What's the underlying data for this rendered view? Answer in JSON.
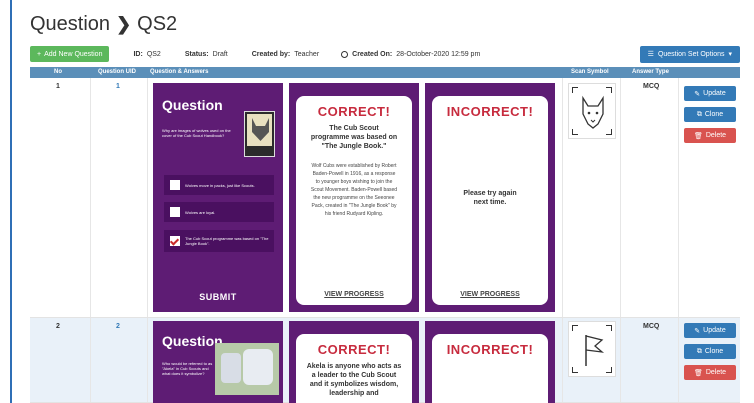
{
  "header": {
    "title": "Question",
    "subtitle": "QS2"
  },
  "info": {
    "add_label": "Add New Question",
    "id_label": "ID:",
    "id_value": "QS2",
    "status_label": "Status:",
    "status_value": "Draft",
    "created_by_label": "Created by:",
    "created_by_value": "Teacher",
    "created_on_label": "Created On:",
    "created_on_value": "28-October-2020 12:59 pm",
    "options_label": "Question Set Options"
  },
  "table": {
    "headers": {
      "no": "No",
      "uid": "Question UID",
      "qa": "Question & Answers",
      "scan": "Scan Symbol",
      "type": "Answer Type"
    }
  },
  "rows": [
    {
      "no": "1",
      "uid": "1",
      "type": "MCQ",
      "question_title": "Question",
      "question_text": "Why are images of wolves used on the cover of the Cub Scout Handbook?",
      "options": [
        "Wolves move in packs, just like Scouts.",
        "Wolves are loyal.",
        "The Cub Scout programme was based on \"The Jungle Book\"."
      ],
      "submit": "SUBMIT",
      "correct_title": "CORRECT!",
      "correct_sub": "The Cub Scout programme was based on \"The Jungle Book.\"",
      "correct_body": "Wolf Cubs were established by Robert Baden-Powell in 1916, as a response to younger boys wishing to join the Scout Movement. Baden-Powell based the new programme on the Seeonee Pack, created in \"The Jungle Book\" by his friend Rudyard Kipling.",
      "incorrect_title": "INCORRECT!",
      "incorrect_body": "Please try again next time.",
      "view_progress": "VIEW PROGRESS",
      "scan_icon": "wolf-icon",
      "actions": {
        "update": "Update",
        "clone": "Clone",
        "delete": "Delete"
      }
    },
    {
      "no": "2",
      "uid": "2",
      "type": "MCQ",
      "question_title": "Question",
      "question_text": "Who would be referred to as \"Akela\" in Cub Scouts and what does it symbolize?",
      "correct_title": "CORRECT!",
      "correct_sub": "Akela is anyone who acts as a leader to the Cub Scout and it symbolizes wisdom, leadership and",
      "incorrect_title": "INCORRECT!",
      "scan_icon": "flag-icon",
      "actions": {
        "update": "Update",
        "clone": "Clone",
        "delete": "Delete"
      }
    }
  ],
  "colors": {
    "card_purple": "#5e1c74",
    "header_blue": "#5b8fb9",
    "add_green": "#5cb85c",
    "primary_blue": "#337ab7",
    "danger_red": "#d9534f",
    "result_red": "#c72b3e"
  }
}
